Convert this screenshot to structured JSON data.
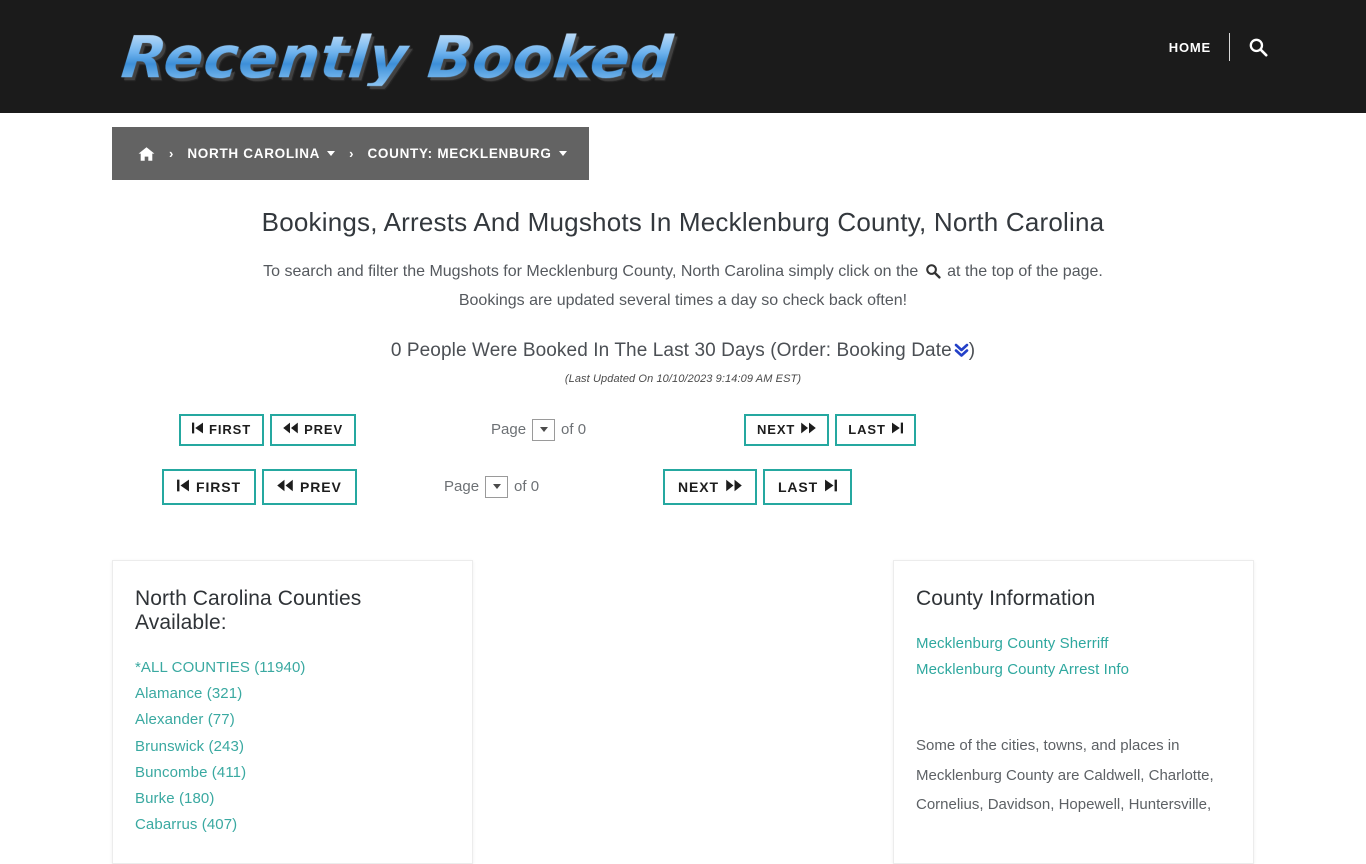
{
  "header": {
    "logo_text": "Recently Booked",
    "nav": {
      "home_label": "HOME",
      "search_icon": "search-icon"
    }
  },
  "breadcrumb": {
    "home_icon": "home-icon",
    "separator": "›",
    "items": [
      {
        "label": "NORTH CAROLINA",
        "has_caret": true
      },
      {
        "label": "COUNTY: MECKLENBURG",
        "has_caret": true
      }
    ]
  },
  "main": {
    "title": "Bookings, Arrests And Mugshots In Mecklenburg County, North Carolina",
    "intro_before": "To search and filter the Mugshots for Mecklenburg County, North Carolina simply click on the",
    "intro_after": "at the top of the page. Bookings are updated several times a day so check back often!",
    "booked_line_before": "0 People Were Booked In The Last 30 Days (Order: Booking Date",
    "booked_line_after": ")",
    "sort_icon": "double-chevron-down-icon",
    "last_updated": "(Last Updated On 10/10/2023 9:14:09 AM EST)"
  },
  "pagination": {
    "first_label": "FIRST",
    "prev_label": "PREV",
    "next_label": "NEXT",
    "last_label": "LAST",
    "first_icon": "skip-to-start-icon",
    "prev_icon": "rewind-icon",
    "next_icon": "fast-forward-icon",
    "last_icon": "skip-to-end-icon",
    "page_label": "Page",
    "of_label": "of 0",
    "page_value": "",
    "select_icon": "chevron-down-icon"
  },
  "counties_panel": {
    "title": "North Carolina Counties Available:",
    "items": [
      "*ALL COUNTIES (11940)",
      "Alamance (321)",
      "Alexander (77)",
      "Brunswick (243)",
      "Buncombe (411)",
      "Burke (180)",
      "Cabarrus (407)"
    ]
  },
  "county_info_panel": {
    "title": "County Information",
    "links": [
      "Mecklenburg County Sherriff",
      "Mecklenburg County Arrest Info"
    ],
    "body": "Some of the cities, towns, and places in Mecklenburg County are Caldwell, Charlotte, Cornelius, Davidson, Hopewell, Huntersville,"
  },
  "colors": {
    "header_bg": "#1b1b1b",
    "breadcrumb_bg": "#636363",
    "accent_teal": "#25a8a0",
    "link_teal": "#3aa9a1",
    "sort_blue": "#2340c8"
  }
}
